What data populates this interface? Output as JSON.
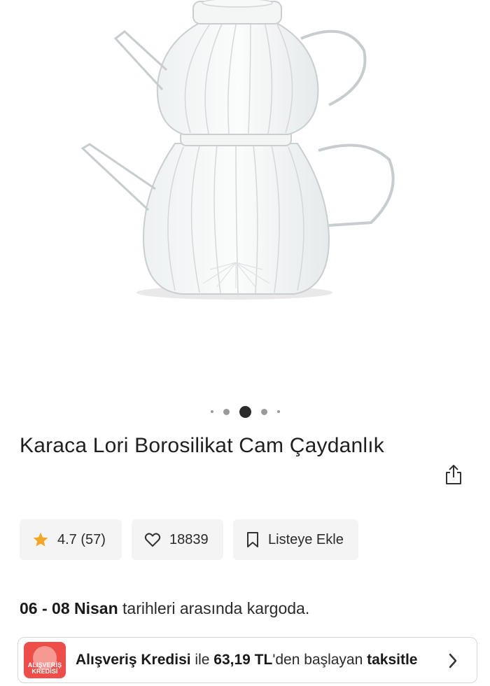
{
  "gallery": {
    "image_alt": "glass-teapot-product-photo",
    "dot_count": 5,
    "active_dot": 3
  },
  "product": {
    "title": "Karaca Lori Borosilikat Cam Çaydanlık",
    "share_icon": "share-icon"
  },
  "chips": {
    "rating": "4.7 (57)",
    "favorites": "18839",
    "list_label": "Listeye Ekle"
  },
  "delivery": {
    "dates": "06 - 08 Nisan",
    "suffix": " tarihleri arasında kargoda."
  },
  "credit": {
    "badge_line1": "ALIŞVERİŞ",
    "badge_line2": "KREDİSİ",
    "part1": "Alışveriş Kredisi",
    "part2": " ile ",
    "amount": "63,19 TL",
    "part3": "'den başlayan ",
    "part4": "taksitle"
  },
  "colors": {
    "star": "#f5a623",
    "badge": "#ee4d4a",
    "active_dot": "#2b2b2b"
  }
}
